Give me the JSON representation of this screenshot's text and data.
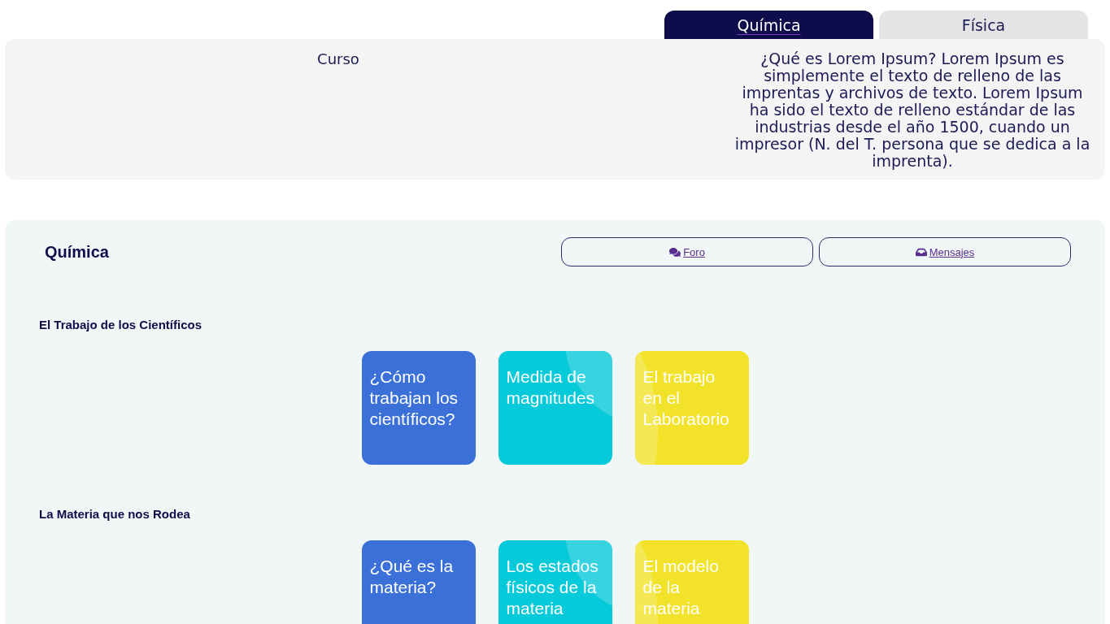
{
  "tabs": [
    {
      "label": "Química",
      "selected": true
    },
    {
      "label": "Física",
      "selected": false
    }
  ],
  "course": {
    "label": "Curso",
    "description": "¿Qué es Lorem Ipsum? Lorem Ipsum es simplemente el texto de relleno de las imprentas y archivos de texto. Lorem Ipsum ha sido el texto de relleno estándar de las industrias desde el año 1500, cuando un impresor (N. del T. persona que se dedica a la imprenta)."
  },
  "subject": {
    "title": "Química",
    "buttons": [
      {
        "label": "Foro",
        "kind": "forum"
      },
      {
        "label": "Mensajes",
        "kind": "messages"
      }
    ]
  },
  "sections": [
    {
      "title": "El Trabajo de los Científicos",
      "lessons": [
        {
          "title": "¿Cómo trabajan los científicos?",
          "color": "#3a70d8"
        },
        {
          "title": "Medida de magnitudes",
          "color": "#06c9d9"
        },
        {
          "title": "El trabajo en el Laboratorio",
          "color": "#f2e32a"
        }
      ]
    },
    {
      "title": "La Materia que nos Rodea",
      "lessons": [
        {
          "title": "¿Qué es la materia?",
          "color": "#3a70d8"
        },
        {
          "title": "Los estados físicos de la materia",
          "color": "#06c9d9"
        },
        {
          "title": "El modelo de la materia",
          "color": "#f2e32a"
        }
      ]
    }
  ]
}
